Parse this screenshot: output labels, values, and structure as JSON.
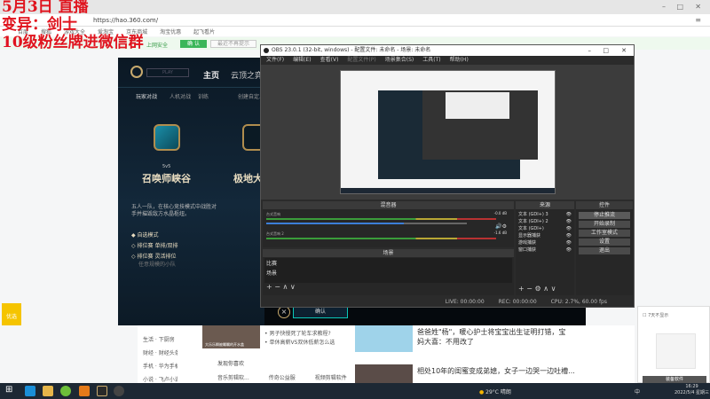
{
  "overlay": {
    "line1": "5月3日 直播",
    "line2": "变异：剑士",
    "line3": "10级粉丝牌进微信群"
  },
  "browser": {
    "url": "https://hao.360.com/",
    "bookmarks": [
      "百度",
      "搜狐",
      "游戏大全",
      "爱淘宝",
      "京东商城",
      "淘宝优惠",
      "起飞看片"
    ],
    "notice": "上网安全",
    "confirm": "确 认",
    "dismiss": "最近不再提示"
  },
  "lol": {
    "play": "PLAY",
    "nav": [
      "主页",
      "云顶之弈"
    ],
    "subnav": [
      "玩家对战",
      "人机对战",
      "训练",
      "创建自定义"
    ],
    "mode_size": "5v5",
    "mode_name": "召唤师峡谷",
    "mode2_name": "极地大乱斗",
    "desc": "五人一队，在核心竞技模式中战胜对手并摧毁敌方水晶枢纽。",
    "options": [
      "自选模式",
      "排位赛 单排/双排",
      "排位赛 灵活排位"
    ],
    "option_sub": "任意规模的小队",
    "confirm": "确认"
  },
  "obs": {
    "title": "OBS 23.0.1 (32-bit, windows) - 配置文件: 未命名 - 场景: 未命名",
    "menu": [
      "文件(F)",
      "编辑(E)",
      "查看(V)",
      "配置文件(P)",
      "场景集合(S)",
      "工具(T)",
      "帮助(H)"
    ],
    "mixer_title": "混音器",
    "tracks": [
      {
        "name": "台式音响",
        "db": "-0.0 dB",
        "level": 0.86
      },
      {
        "name": "台式音响 2",
        "db": "-1.6 dB",
        "level": 0.8
      }
    ],
    "scenes_title": "场景",
    "scenes": [
      "比赛",
      "场景"
    ],
    "sources_title": "来源",
    "sources": [
      "文本 (GDI+) 3",
      "文本 (GDI+) 2",
      "文本 (GDI+)",
      "显示器捕获",
      "游戏捕获",
      "窗口捕获"
    ],
    "controls_title": "控件",
    "controls": [
      "停止推流",
      "开始录制",
      "工作室模式",
      "设置",
      "退出"
    ],
    "status": {
      "live": "LIVE: 00:00:00",
      "rec": "REC: 00:00:00",
      "cpu": "CPU: 2.7%, 60.00 fps"
    }
  },
  "news": {
    "leftnav": [
      "生活 · 下厨房",
      "财经 · 财经头条",
      "手机 · 华为手机",
      "小说 · 飞卢小说网"
    ],
    "video_caption": "大乐乐瞬被瞩瞩的开水盖",
    "bullets": [
      "男子快慢死了轮车求教程?",
      "单休高薪VS双休低薪怎么选"
    ],
    "follow_title": "发现你喜欢",
    "tags": [
      "音乐剪辑软...",
      "传奇公益服",
      "视频剪辑软件"
    ],
    "headline1": "爸爸姓\"杨\"，暖心护士将宝宝出生证明打错，宝妈大喜：不用改了",
    "headline2": "相处10年的闺蜜变成弟媳，女子一边哭一边吐槽...",
    "badge": "优选"
  },
  "popup": {
    "checkbox": "7天不显示",
    "button": "装备软件"
  },
  "taskbar": {
    "weather": "29°C 晴朗",
    "time": "16:29",
    "date": "2022/5/4 星期三",
    "ime": "中"
  }
}
